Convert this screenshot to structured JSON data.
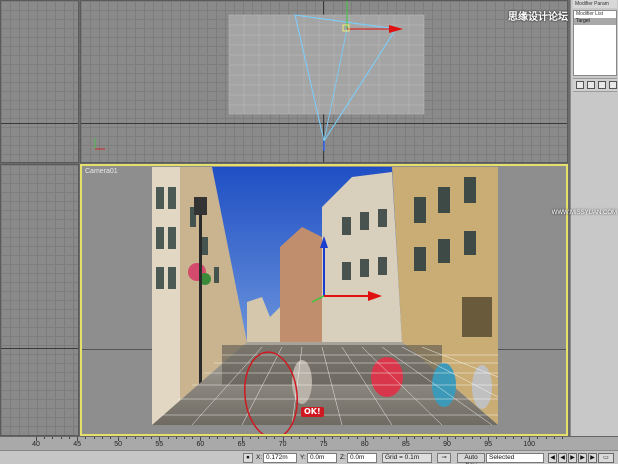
{
  "viewports": {
    "camera_label": "Camera01"
  },
  "annotation": {
    "ok_label": "OK!"
  },
  "command_panel": {
    "header": "Modifier Param",
    "modifier_list_label": "Modifier List",
    "stack_item": "Target"
  },
  "watermark": {
    "top": "思缘设计论坛",
    "side": "WWW.MISSYUAN.COM"
  },
  "timeline": {
    "ticks": [
      "40",
      "45",
      "50",
      "55",
      "60",
      "65",
      "70",
      "75",
      "80",
      "85",
      "90",
      "95",
      "100"
    ]
  },
  "status_bar": {
    "x_label": "X:",
    "x_value": "0.172m",
    "y_label": "Y:",
    "y_value": "0.0m",
    "z_label": "Z:",
    "z_value": "0.0m",
    "grid_value": "Grid = 0.1m",
    "auto_key": "Auto Key",
    "selection": "Selected"
  },
  "colors": {
    "camera_border": "#e5e06b",
    "annotation_red": "#d01820",
    "gizmo_blue": "#1a3ccf",
    "gizmo_red": "#e01010"
  }
}
